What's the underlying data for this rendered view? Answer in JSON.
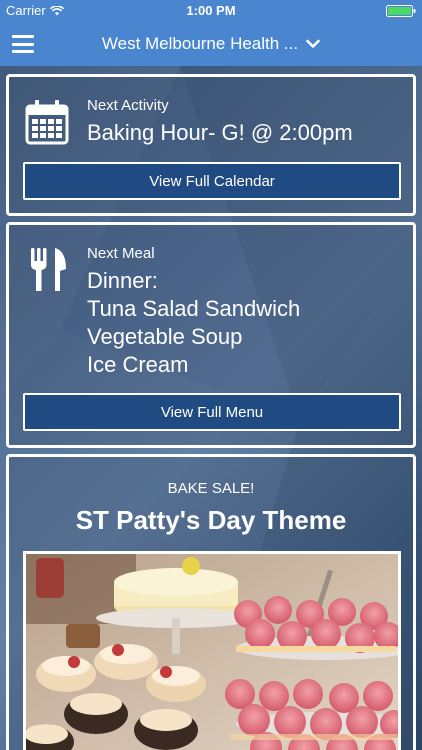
{
  "status_bar": {
    "carrier": "Carrier",
    "time": "1:00 PM"
  },
  "nav": {
    "title": "West Melbourne Health  ...",
    "menu_icon": "hamburger-icon",
    "dropdown_icon": "chevron-down-icon"
  },
  "activity": {
    "label": "Next Activity",
    "value": "Baking Hour- G! @ 2:00pm",
    "button": "View Full Calendar",
    "icon": "calendar-icon"
  },
  "meal": {
    "label": "Next Meal",
    "lines": [
      "Dinner:",
      "Tuna Salad Sandwich",
      "Vegetable Soup",
      "Ice Cream"
    ],
    "button": "View Full Menu",
    "icon": "fork-knife-icon"
  },
  "promo": {
    "subtitle": "BAKE SALE!",
    "title": "ST Patty's Day Theme"
  },
  "colors": {
    "nav_blue": "#4a85cf",
    "button_blue": "#1f4a82"
  }
}
